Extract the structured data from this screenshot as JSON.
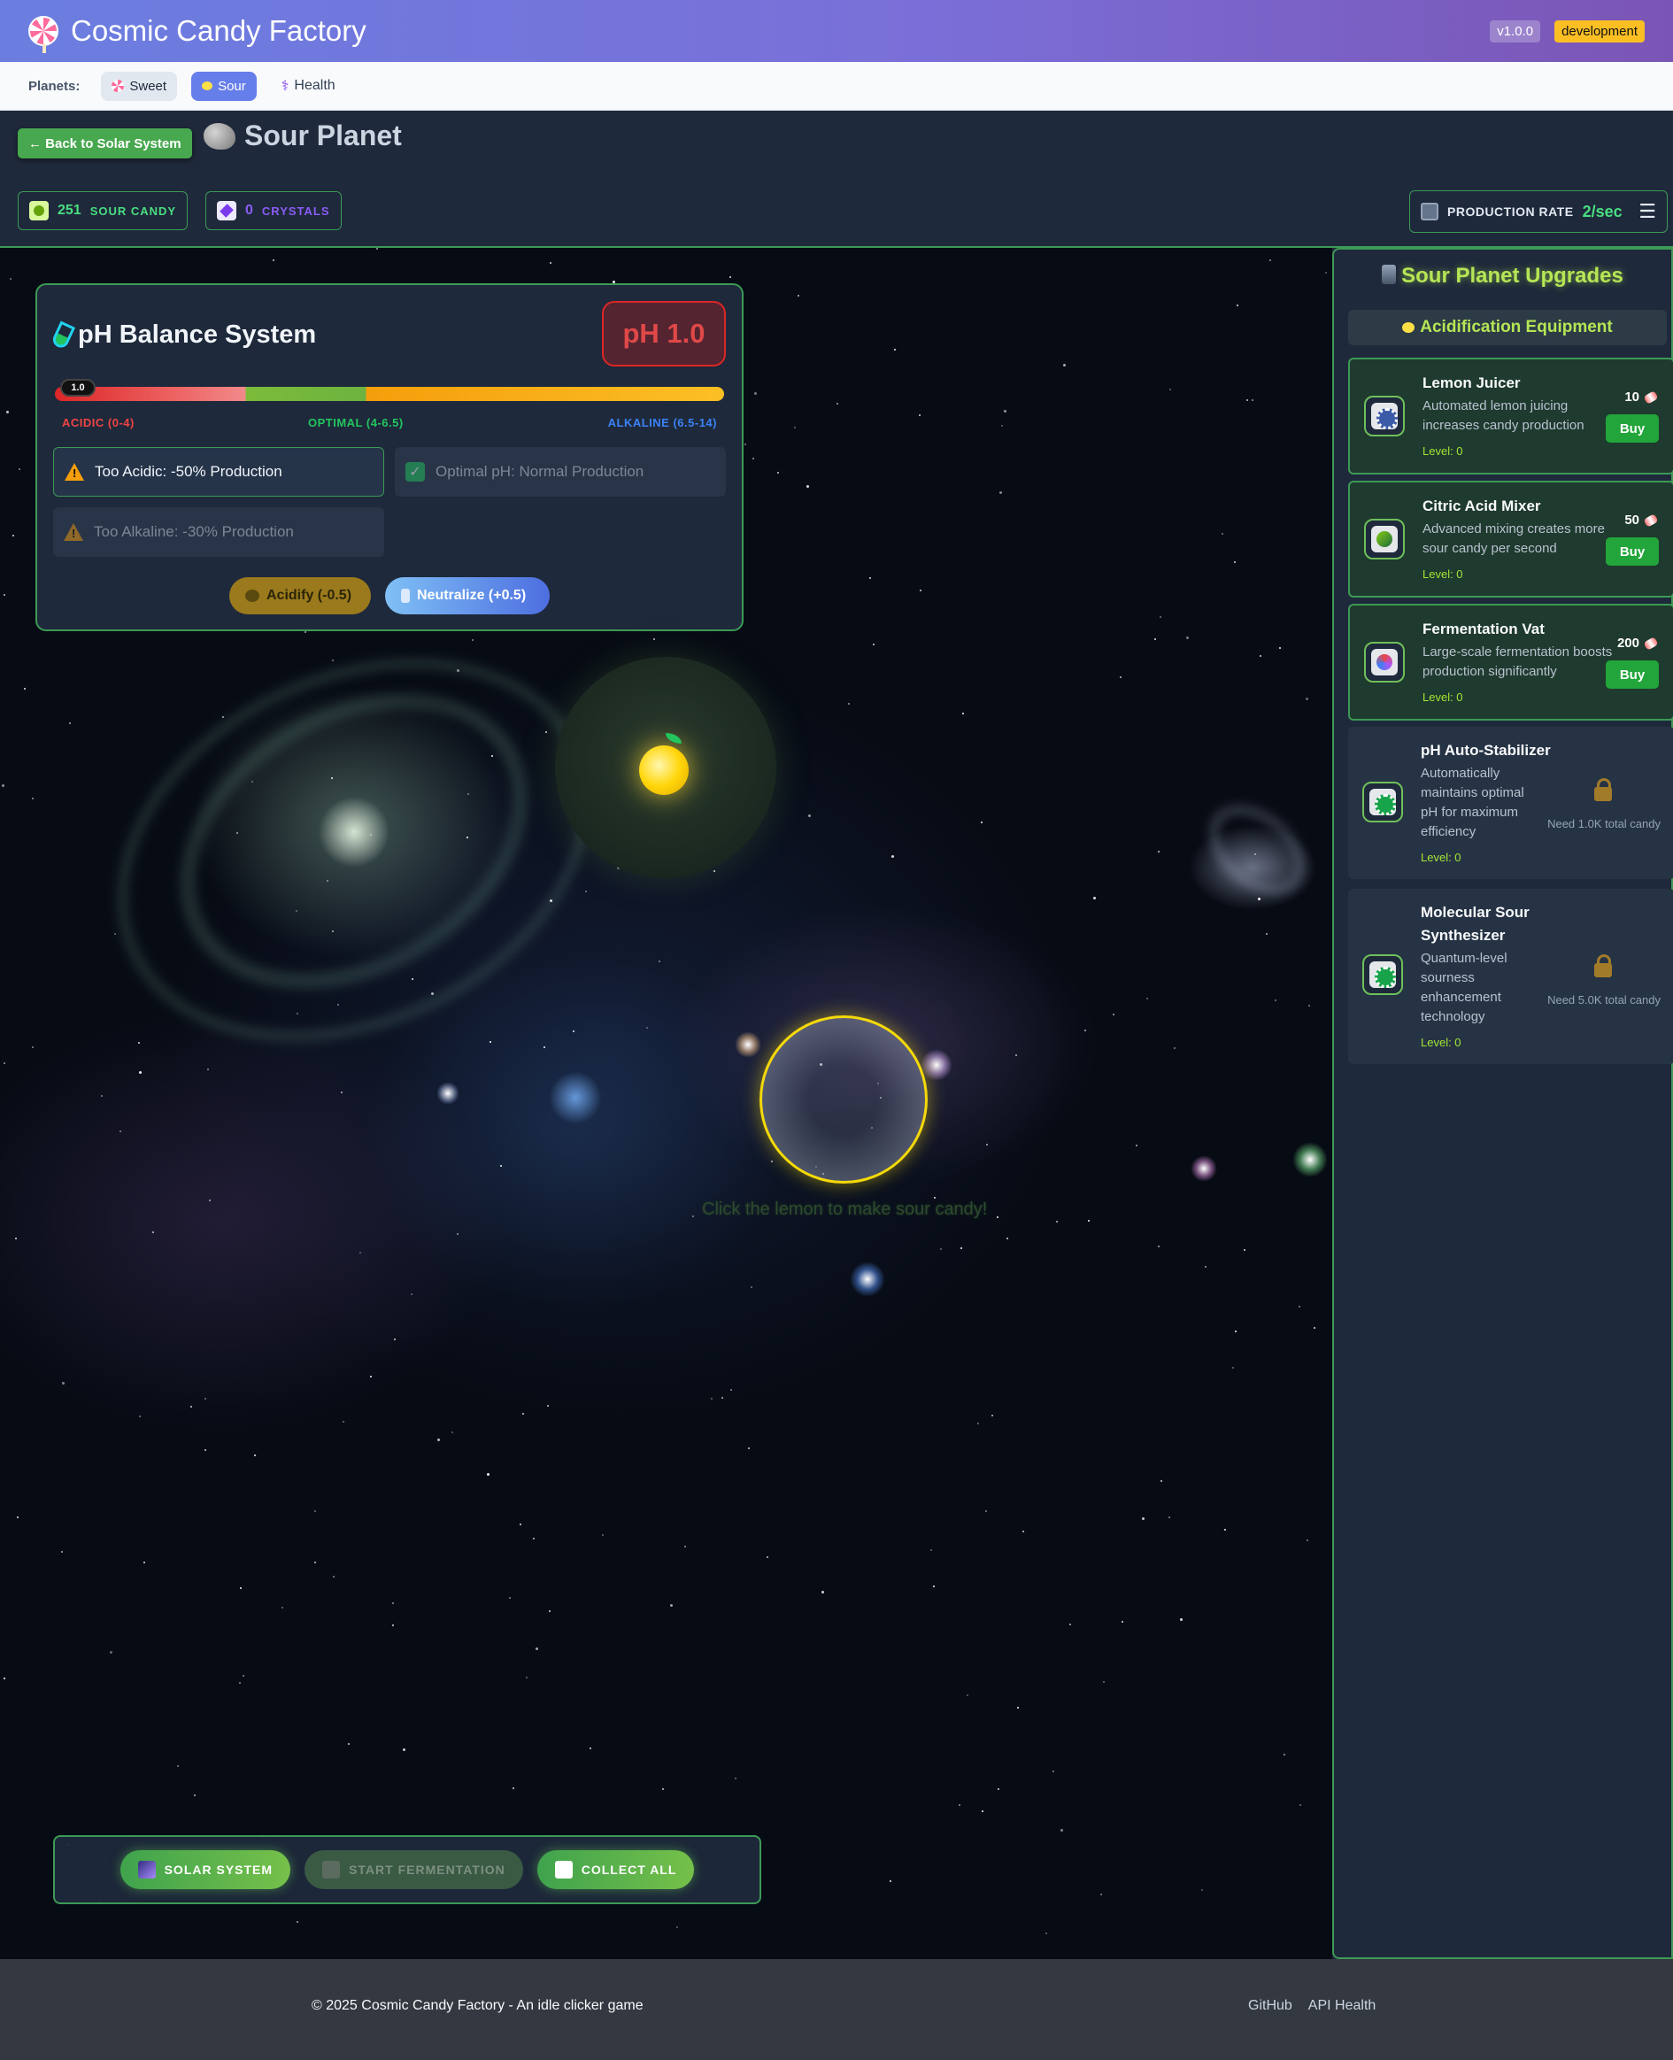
{
  "header": {
    "title": "Cosmic Candy Factory",
    "version": "v1.0.0",
    "environment": "development",
    "logo_icon": "lollipop-icon"
  },
  "planet_nav": {
    "label": "Planets:",
    "planets": [
      {
        "label": "Sweet",
        "icon": "lollipop-icon",
        "active": false
      },
      {
        "label": "Sour",
        "icon": "lemon-icon",
        "active": true
      },
      {
        "label": "Health",
        "icon": "caduceus-icon",
        "active": false
      }
    ]
  },
  "game_bar": {
    "back_label": "← Back to Solar System",
    "planet_title": "Sour Planet",
    "resources": {
      "sour_candy": {
        "value": "251",
        "label": "SOUR CANDY"
      },
      "crystals": {
        "value": "0",
        "label": "CRYSTALS"
      }
    },
    "production": {
      "label": "PRODUCTION RATE",
      "value": "2/sec"
    }
  },
  "ph_panel": {
    "title": "pH Balance System",
    "current": "pH 1.0",
    "marker": "1.0",
    "level": 1.0,
    "scale": {
      "acidic": "ACIDIC (0-4)",
      "optimal": "OPTIMAL (4-6.5)",
      "alkaline": "ALKALINE (6.5-14)"
    },
    "statuses": {
      "acidic": "Too Acidic: -50% Production",
      "optimal": "Optimal pH: Normal Production",
      "alkaline": "Too Alkaline: -30% Production"
    },
    "buttons": {
      "acidify": "Acidify (-0.5)",
      "neutralize": "Neutralize (+0.5)"
    }
  },
  "scene": {
    "click_hint": "Click the lemon to make sour candy!"
  },
  "action_bar": {
    "solar_system": "SOLAR SYSTEM",
    "start_fermentation": "START FERMENTATION",
    "collect_all": "COLLECT ALL"
  },
  "upgrades": {
    "title": "Sour Planet Upgrades",
    "section": "Acidification Equipment",
    "buy_label": "Buy",
    "items": [
      {
        "name": "Lemon Juicer",
        "desc": "Automated lemon juicing increases candy production",
        "level": "Level: 0",
        "cost": "10",
        "locked": false
      },
      {
        "name": "Citric Acid Mixer",
        "desc": "Advanced mixing creates more sour candy per second",
        "level": "Level: 0",
        "cost": "50",
        "locked": false
      },
      {
        "name": "Fermentation Vat",
        "desc": "Large-scale fermentation boosts production significantly",
        "level": "Level: 0",
        "cost": "200",
        "locked": false
      },
      {
        "name": "pH Auto-Stabilizer",
        "desc": "Automatically maintains optimal pH for maximum efficiency",
        "level": "Level: 0",
        "need": "Need 1.0K total candy",
        "locked": true
      },
      {
        "name": "Molecular Sour Synthesizer",
        "desc": "Quantum-level sourness enhancement technology",
        "level": "Level: 0",
        "need": "Need 5.0K total candy",
        "locked": true
      }
    ]
  },
  "footer": {
    "copyright": "© 2025 Cosmic Candy Factory - An idle clicker game",
    "links": [
      "GitHub",
      "API Health"
    ]
  }
}
